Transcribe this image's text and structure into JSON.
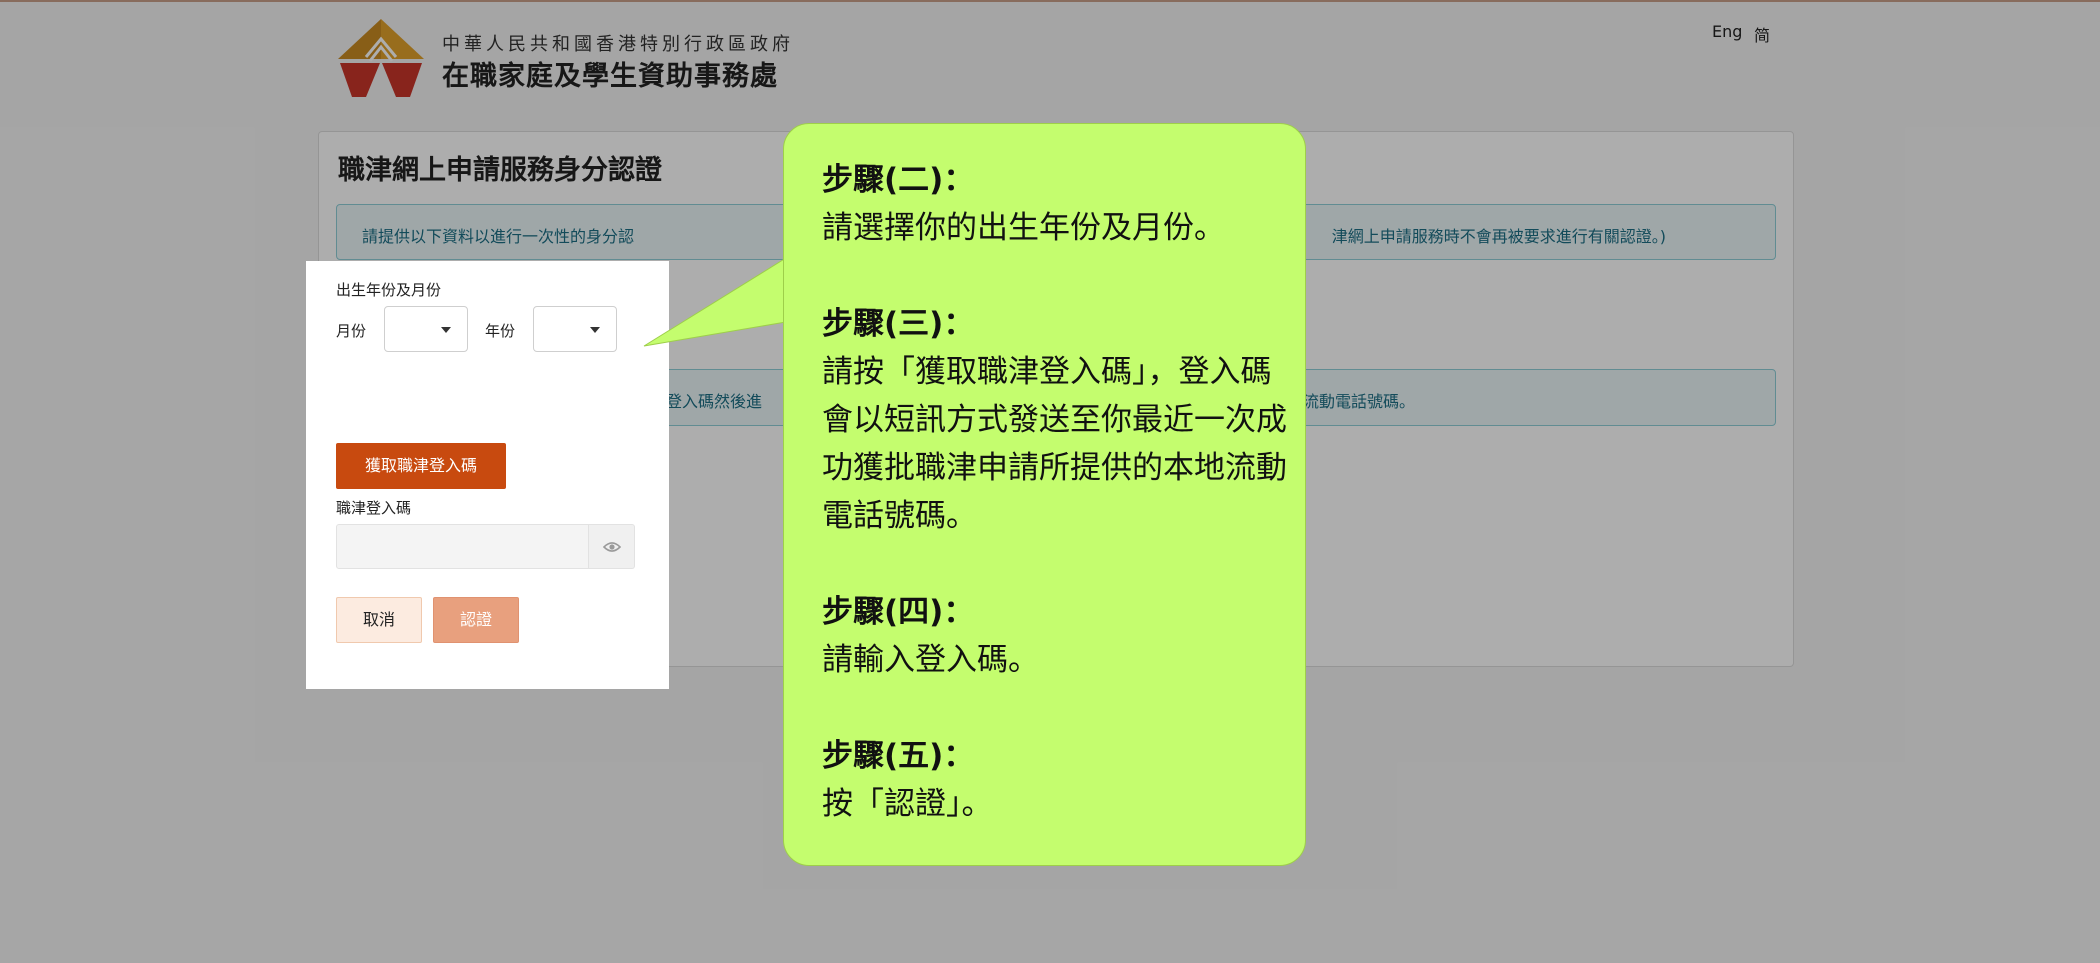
{
  "header": {
    "org_subtitle": "中華人民共和國香港特別行政區政府",
    "org_title": "在職家庭及學生資助事務處",
    "lang_english": "Eng",
    "lang_simplified": "简"
  },
  "card": {
    "title": "職津網上申請服務身分認證",
    "notice_left": "請提供以下資料以進行一次性的身分認",
    "notice_right": "津網上申請服務時不會再被要求進行有關認證。)",
    "sms_notice_left": "請按以下「獲取職津登入碼」按鈕收取職津登入碼然後進",
    "sms_notice_right": "流動電話號碼。"
  },
  "form": {
    "dob_label": "出生年份及月份",
    "month_label": "月份",
    "year_label": "年份",
    "month_value": "",
    "year_value": "",
    "get_code_button": "獲取職津登入碼",
    "code_label": "職津登入碼",
    "code_value": "",
    "cancel_button": "取消",
    "verify_button": "認證"
  },
  "callout": {
    "steps": [
      {
        "heading": "步驟(二)：",
        "body": "請選擇你的出生年份及月份。"
      },
      {
        "heading": "步驟(三)：",
        "body": "請按「獲取職津登入碼」，登入碼會以短訊方式發送至你最近一次成功獲批職津申請所提供的本地流動電話號碼。"
      },
      {
        "heading": "步驟(四)：",
        "body": "請輸入登入碼。"
      },
      {
        "heading": "步驟(五)：",
        "body": "按「認證」。"
      }
    ]
  },
  "colors": {
    "primary_button": "#c84a0f",
    "callout_fill": "#c4fd6e",
    "alert_text": "#1c6f85",
    "logo_gold": "#e0a12b",
    "logo_red": "#c9352a"
  }
}
